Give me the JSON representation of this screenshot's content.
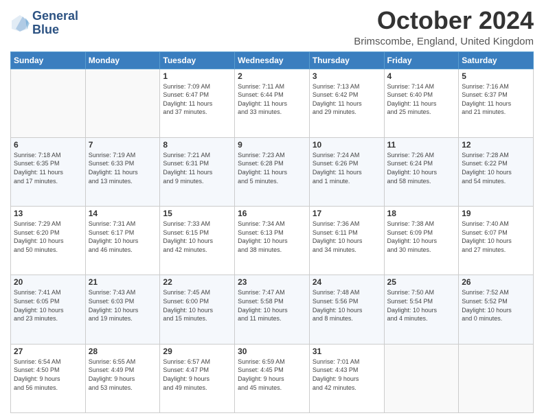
{
  "logo": {
    "line1": "General",
    "line2": "Blue"
  },
  "title": "October 2024",
  "location": "Brimscombe, England, United Kingdom",
  "days_header": [
    "Sunday",
    "Monday",
    "Tuesday",
    "Wednesday",
    "Thursday",
    "Friday",
    "Saturday"
  ],
  "weeks": [
    [
      {
        "day": "",
        "info": ""
      },
      {
        "day": "",
        "info": ""
      },
      {
        "day": "1",
        "info": "Sunrise: 7:09 AM\nSunset: 6:47 PM\nDaylight: 11 hours\nand 37 minutes."
      },
      {
        "day": "2",
        "info": "Sunrise: 7:11 AM\nSunset: 6:44 PM\nDaylight: 11 hours\nand 33 minutes."
      },
      {
        "day": "3",
        "info": "Sunrise: 7:13 AM\nSunset: 6:42 PM\nDaylight: 11 hours\nand 29 minutes."
      },
      {
        "day": "4",
        "info": "Sunrise: 7:14 AM\nSunset: 6:40 PM\nDaylight: 11 hours\nand 25 minutes."
      },
      {
        "day": "5",
        "info": "Sunrise: 7:16 AM\nSunset: 6:37 PM\nDaylight: 11 hours\nand 21 minutes."
      }
    ],
    [
      {
        "day": "6",
        "info": "Sunrise: 7:18 AM\nSunset: 6:35 PM\nDaylight: 11 hours\nand 17 minutes."
      },
      {
        "day": "7",
        "info": "Sunrise: 7:19 AM\nSunset: 6:33 PM\nDaylight: 11 hours\nand 13 minutes."
      },
      {
        "day": "8",
        "info": "Sunrise: 7:21 AM\nSunset: 6:31 PM\nDaylight: 11 hours\nand 9 minutes."
      },
      {
        "day": "9",
        "info": "Sunrise: 7:23 AM\nSunset: 6:28 PM\nDaylight: 11 hours\nand 5 minutes."
      },
      {
        "day": "10",
        "info": "Sunrise: 7:24 AM\nSunset: 6:26 PM\nDaylight: 11 hours\nand 1 minute."
      },
      {
        "day": "11",
        "info": "Sunrise: 7:26 AM\nSunset: 6:24 PM\nDaylight: 10 hours\nand 58 minutes."
      },
      {
        "day": "12",
        "info": "Sunrise: 7:28 AM\nSunset: 6:22 PM\nDaylight: 10 hours\nand 54 minutes."
      }
    ],
    [
      {
        "day": "13",
        "info": "Sunrise: 7:29 AM\nSunset: 6:20 PM\nDaylight: 10 hours\nand 50 minutes."
      },
      {
        "day": "14",
        "info": "Sunrise: 7:31 AM\nSunset: 6:17 PM\nDaylight: 10 hours\nand 46 minutes."
      },
      {
        "day": "15",
        "info": "Sunrise: 7:33 AM\nSunset: 6:15 PM\nDaylight: 10 hours\nand 42 minutes."
      },
      {
        "day": "16",
        "info": "Sunrise: 7:34 AM\nSunset: 6:13 PM\nDaylight: 10 hours\nand 38 minutes."
      },
      {
        "day": "17",
        "info": "Sunrise: 7:36 AM\nSunset: 6:11 PM\nDaylight: 10 hours\nand 34 minutes."
      },
      {
        "day": "18",
        "info": "Sunrise: 7:38 AM\nSunset: 6:09 PM\nDaylight: 10 hours\nand 30 minutes."
      },
      {
        "day": "19",
        "info": "Sunrise: 7:40 AM\nSunset: 6:07 PM\nDaylight: 10 hours\nand 27 minutes."
      }
    ],
    [
      {
        "day": "20",
        "info": "Sunrise: 7:41 AM\nSunset: 6:05 PM\nDaylight: 10 hours\nand 23 minutes."
      },
      {
        "day": "21",
        "info": "Sunrise: 7:43 AM\nSunset: 6:03 PM\nDaylight: 10 hours\nand 19 minutes."
      },
      {
        "day": "22",
        "info": "Sunrise: 7:45 AM\nSunset: 6:00 PM\nDaylight: 10 hours\nand 15 minutes."
      },
      {
        "day": "23",
        "info": "Sunrise: 7:47 AM\nSunset: 5:58 PM\nDaylight: 10 hours\nand 11 minutes."
      },
      {
        "day": "24",
        "info": "Sunrise: 7:48 AM\nSunset: 5:56 PM\nDaylight: 10 hours\nand 8 minutes."
      },
      {
        "day": "25",
        "info": "Sunrise: 7:50 AM\nSunset: 5:54 PM\nDaylight: 10 hours\nand 4 minutes."
      },
      {
        "day": "26",
        "info": "Sunrise: 7:52 AM\nSunset: 5:52 PM\nDaylight: 10 hours\nand 0 minutes."
      }
    ],
    [
      {
        "day": "27",
        "info": "Sunrise: 6:54 AM\nSunset: 4:50 PM\nDaylight: 9 hours\nand 56 minutes."
      },
      {
        "day": "28",
        "info": "Sunrise: 6:55 AM\nSunset: 4:49 PM\nDaylight: 9 hours\nand 53 minutes."
      },
      {
        "day": "29",
        "info": "Sunrise: 6:57 AM\nSunset: 4:47 PM\nDaylight: 9 hours\nand 49 minutes."
      },
      {
        "day": "30",
        "info": "Sunrise: 6:59 AM\nSunset: 4:45 PM\nDaylight: 9 hours\nand 45 minutes."
      },
      {
        "day": "31",
        "info": "Sunrise: 7:01 AM\nSunset: 4:43 PM\nDaylight: 9 hours\nand 42 minutes."
      },
      {
        "day": "",
        "info": ""
      },
      {
        "day": "",
        "info": ""
      }
    ]
  ]
}
